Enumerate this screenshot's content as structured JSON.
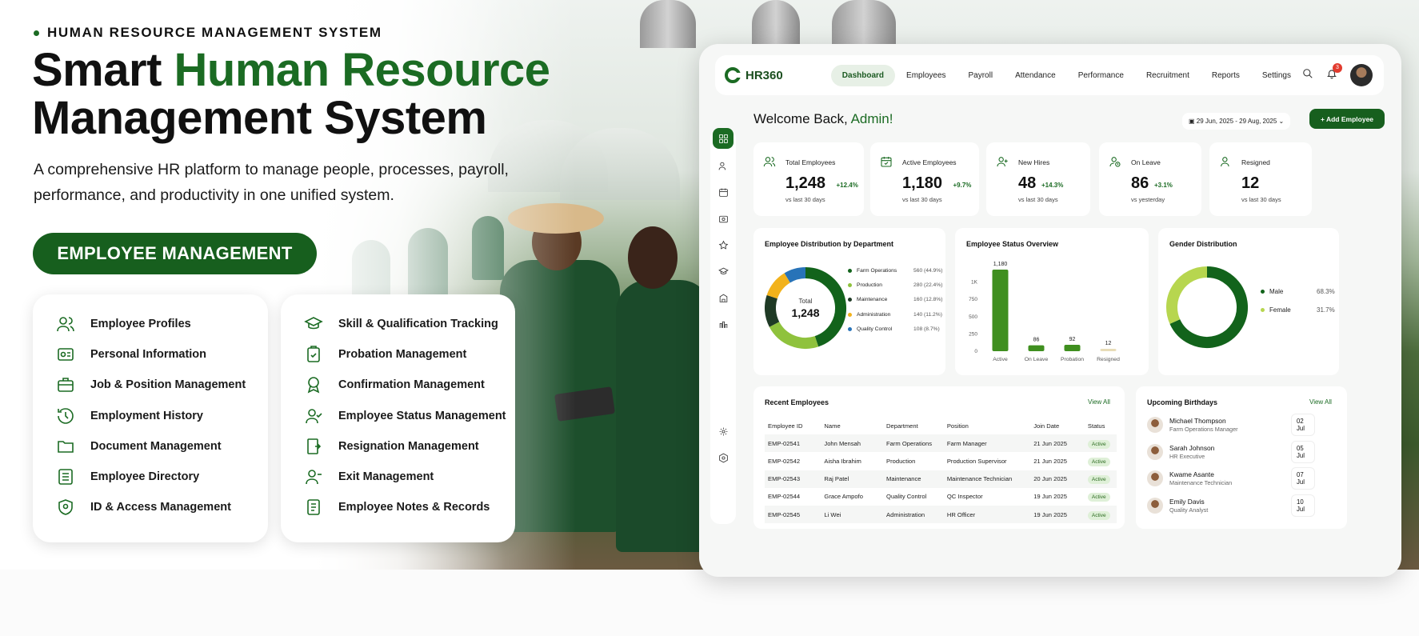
{
  "hero": {
    "eyebrow": "HUMAN RESOURCE MANAGEMENT SYSTEM",
    "title_part1": "Smart ",
    "title_green": "Human Resource",
    "title_line2": "Management System",
    "lead": "A comprehensive HR platform to manage people, processes, payroll, performance, and productivity in one unified system.",
    "pill": "EMPLOYEE MANAGEMENT",
    "brand_color": "#1b6b23"
  },
  "features_left": [
    {
      "label": "Employee Profiles",
      "icon": "users-icon"
    },
    {
      "label": "Personal Information",
      "icon": "id-card-icon"
    },
    {
      "label": "Job & Position Management",
      "icon": "briefcase-icon"
    },
    {
      "label": "Employment History",
      "icon": "history-icon"
    },
    {
      "label": "Document Management",
      "icon": "folder-icon"
    },
    {
      "label": "Employee Directory",
      "icon": "list-icon"
    },
    {
      "label": "ID & Access Management",
      "icon": "shield-icon"
    }
  ],
  "features_right": [
    {
      "label": "Skill & Qualification Tracking",
      "icon": "graduation-cap-icon"
    },
    {
      "label": "Probation Management",
      "icon": "clipboard-check-icon"
    },
    {
      "label": "Confirmation Management",
      "icon": "award-icon"
    },
    {
      "label": "Employee Status Management",
      "icon": "user-check-icon"
    },
    {
      "label": "Resignation Management",
      "icon": "exit-door-icon"
    },
    {
      "label": "Exit Management",
      "icon": "user-exit-icon"
    },
    {
      "label": "Employee Notes & Records",
      "icon": "notes-icon"
    }
  ],
  "dashboard": {
    "logo": "HR360",
    "nav": [
      "Dashboard",
      "Employees",
      "Payroll",
      "Attendance",
      "Performance",
      "Recruitment",
      "Reports",
      "Settings"
    ],
    "notification_count": "3",
    "welcome_prefix": "Welcome Back, ",
    "welcome_name": "Admin!",
    "date_range": "29 Jun, 2025 - 29 Aug, 2025",
    "add_employee": "+ Add Employee",
    "kpis": [
      {
        "label": "Total Employees",
        "value": "1,248",
        "change": "+12.4%",
        "sub": "vs last 30 days",
        "icon": "users-icon"
      },
      {
        "label": "Active Employees",
        "value": "1,180",
        "change": "+9.7%",
        "sub": "vs last 30 days",
        "icon": "calendar-check-icon"
      },
      {
        "label": "New Hires",
        "value": "48",
        "change": "+14.3%",
        "sub": "vs last 30 days",
        "icon": "user-plus-icon"
      },
      {
        "label": "On Leave",
        "value": "86",
        "change": "+3.1%",
        "sub": "vs yesterday",
        "icon": "user-clock-icon"
      },
      {
        "label": "Resigned",
        "value": "12",
        "change": "",
        "sub": "vs last 30 days",
        "icon": "user-minus-icon"
      }
    ],
    "dept_title": "Employee Distribution by Department",
    "dept_center_label": "Total",
    "dept_center_value": "1,248",
    "status_title": "Employee Status Overview",
    "gender_title": "Gender Distribution",
    "recent_title": "Recent Employees",
    "view_all": "View All",
    "table_headers": [
      "Employee ID",
      "Name",
      "Department",
      "Position",
      "Join Date",
      "Status"
    ],
    "table_rows": [
      [
        "EMP-02541",
        "John Mensah",
        "Farm Operations",
        "Farm Manager",
        "21 Jun 2025",
        "Active"
      ],
      [
        "EMP-02542",
        "Aisha Ibrahim",
        "Production",
        "Production Supervisor",
        "21 Jun 2025",
        "Active"
      ],
      [
        "EMP-02543",
        "Raj Patel",
        "Maintenance",
        "Maintenance Technician",
        "20 Jun 2025",
        "Active"
      ],
      [
        "EMP-02544",
        "Grace Ampofo",
        "Quality Control",
        "QC Inspector",
        "19 Jun 2025",
        "Active"
      ],
      [
        "EMP-02545",
        "Li Wei",
        "Administration",
        "HR Officer",
        "19 Jun 2025",
        "Active"
      ]
    ],
    "birthdays_title": "Upcoming Birthdays",
    "birthdays": [
      {
        "name": "Michael Thompson",
        "role": "Farm Operations Manager",
        "date": "02 Jul"
      },
      {
        "name": "Sarah Johnson",
        "role": "HR Executive",
        "date": "05 Jul"
      },
      {
        "name": "Kwame Asante",
        "role": "Maintenance Technician",
        "date": "07 Jul"
      },
      {
        "name": "Emily Davis",
        "role": "Quality Analyst",
        "date": "10 Jul"
      }
    ]
  },
  "chart_data": [
    {
      "type": "pie",
      "title": "Employee Distribution by Department",
      "categories": [
        "Farm Operations",
        "Production",
        "Maintenance",
        "Administration",
        "Quality Control"
      ],
      "values": [
        560,
        280,
        160,
        140,
        108
      ],
      "labels": [
        "560 (44.9%)",
        "280 (22.4%)",
        "160 (12.8%)",
        "140 (11.2%)",
        "108 (8.7%)"
      ],
      "colors": [
        "#12631b",
        "#8fc23d",
        "#1f3a25",
        "#f2b21b",
        "#2873b8"
      ]
    },
    {
      "type": "bar",
      "title": "Employee Status Overview",
      "categories": [
        "Active",
        "On Leave",
        "Probation",
        "Resigned"
      ],
      "values": [
        1180,
        86,
        92,
        12
      ],
      "ytick_labels": [
        "1K",
        "750",
        "500",
        "250",
        "0"
      ],
      "ylim": [
        0,
        1250
      ],
      "colors": [
        "#3f8f1f",
        "#3f8f1f",
        "#3f8f1f",
        "#e8dcb8"
      ]
    },
    {
      "type": "pie",
      "title": "Gender Distribution",
      "categories": [
        "Male",
        "Female"
      ],
      "values": [
        68.3,
        31.7
      ],
      "labels": [
        "68.3%",
        "31.7%"
      ],
      "colors": [
        "#12631b",
        "#b7d64f"
      ]
    }
  ]
}
